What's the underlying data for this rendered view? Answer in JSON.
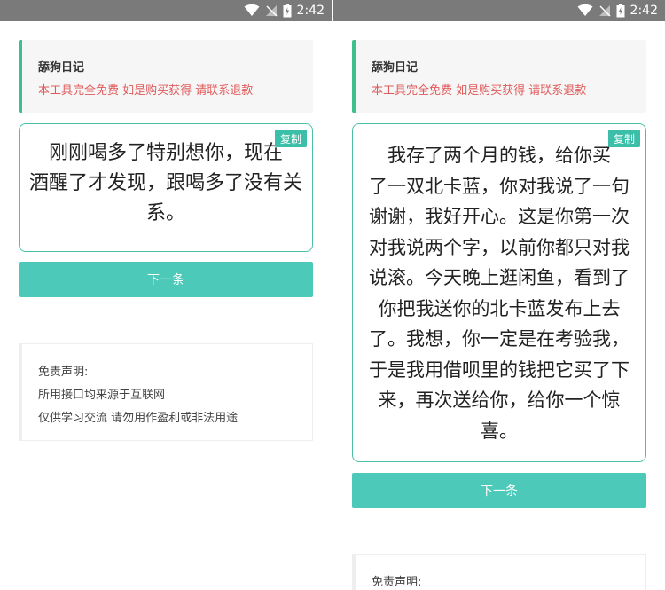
{
  "status_bar": {
    "time": "2:42",
    "icons": [
      "wifi-icon",
      "no-signal-icon",
      "battery-charging-icon"
    ]
  },
  "screens": [
    {
      "info": {
        "title": "舔狗日记",
        "notice": "本工具完全免费 如是购买获得 请联系退款"
      },
      "copy_label": "复制",
      "quote_lines": [
        "刚刚喝多了特别想你，现在",
        "酒醒了才发现，跟喝多了没有关",
        "系。"
      ],
      "next_label": "下一条",
      "disclaimer": {
        "title": "免责声明:",
        "line1": "所用接口均来源于互联网",
        "line2": "仅供学习交流 请勿用作盈利或非法用途"
      }
    },
    {
      "info": {
        "title": "舔狗日记",
        "notice": "本工具完全免费 如是购买获得 请联系退款"
      },
      "copy_label": "复制",
      "quote_lines": [
        "我存了两个月的钱，给你买",
        "了一双北卡蓝，你对我说了一句",
        "谢谢，我好开心。这是你第一次",
        "对我说两个字，以前你都只对我",
        "说滚。今天晚上逛闲鱼，看到了",
        "你把我送你的北卡蓝发布上去",
        "了。我想，你一定是在考验我，",
        "于是我用借呗里的钱把它买了下",
        "来，再次送给你，给你一个惊",
        "喜。"
      ],
      "next_label": "下一条",
      "disclaimer": {
        "title": "免责声明:"
      }
    }
  ],
  "colors": {
    "status_bar": "#7a7a7a",
    "accent_green": "#3dbf8e",
    "notice_red": "#e05a5a",
    "teal_button": "#4cc9b9",
    "copy_button": "#3bbfa9"
  }
}
